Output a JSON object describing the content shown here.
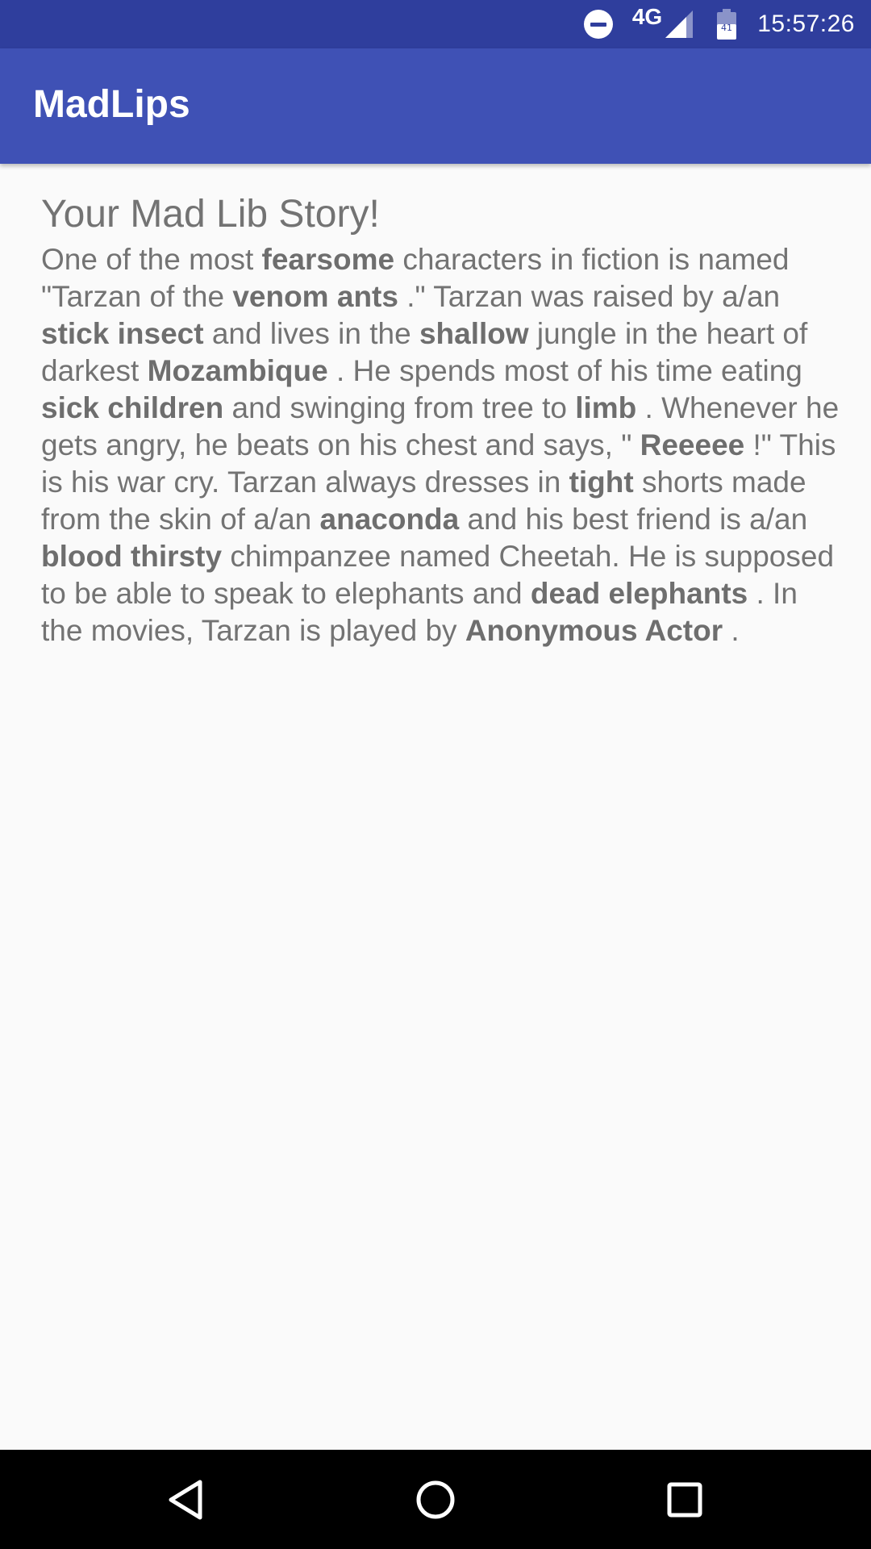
{
  "status_bar": {
    "network": "4G",
    "battery_level": "41",
    "time": "15:57:26",
    "icons": [
      "do-not-disturb-icon",
      "signal-icon",
      "battery-icon"
    ]
  },
  "app_bar": {
    "title": "MadLips"
  },
  "story": {
    "heading": "Your Mad Lib Story!",
    "segments": [
      {
        "text": "One of the most ",
        "bold": false
      },
      {
        "text": "fearsome",
        "bold": true
      },
      {
        "text": " characters in fiction is named \"Tarzan of the ",
        "bold": false
      },
      {
        "text": "venom ants",
        "bold": true
      },
      {
        "text": " .\" Tarzan was raised by a/an ",
        "bold": false
      },
      {
        "text": "stick insect",
        "bold": true
      },
      {
        "text": " and lives in the ",
        "bold": false
      },
      {
        "text": "shallow",
        "bold": true
      },
      {
        "text": " jungle in the heart of darkest ",
        "bold": false
      },
      {
        "text": "Mozambique",
        "bold": true
      },
      {
        "text": " . He spends most of his time eating ",
        "bold": false
      },
      {
        "text": "sick children",
        "bold": true
      },
      {
        "text": " and swinging from tree to ",
        "bold": false
      },
      {
        "text": "limb",
        "bold": true
      },
      {
        "text": " . Whenever he gets angry, he beats on his chest and says, \" ",
        "bold": false
      },
      {
        "text": "Reeeee",
        "bold": true
      },
      {
        "text": " !\" This is his war cry. Tarzan always dresses in ",
        "bold": false
      },
      {
        "text": "tight",
        "bold": true
      },
      {
        "text": " shorts made from the skin of a/an ",
        "bold": false
      },
      {
        "text": "anaconda",
        "bold": true
      },
      {
        "text": " and his best friend is a/an ",
        "bold": false
      },
      {
        "text": "blood thirsty",
        "bold": true
      },
      {
        "text": " chimpanzee named Cheetah. He is supposed to be able to speak to elephants and ",
        "bold": false
      },
      {
        "text": "dead elephants",
        "bold": true
      },
      {
        "text": " . In the movies, Tarzan is played by ",
        "bold": false
      },
      {
        "text": "Anonymous Actor",
        "bold": true
      },
      {
        "text": " .",
        "bold": false
      }
    ]
  },
  "nav_bar": {
    "buttons": [
      "back-button",
      "home-button",
      "recents-button"
    ]
  },
  "colors": {
    "status_bar": "#2f3e9d",
    "app_bar": "#3f51b5",
    "background": "#fafafa",
    "text": "#737373",
    "nav_bar": "#000000"
  }
}
